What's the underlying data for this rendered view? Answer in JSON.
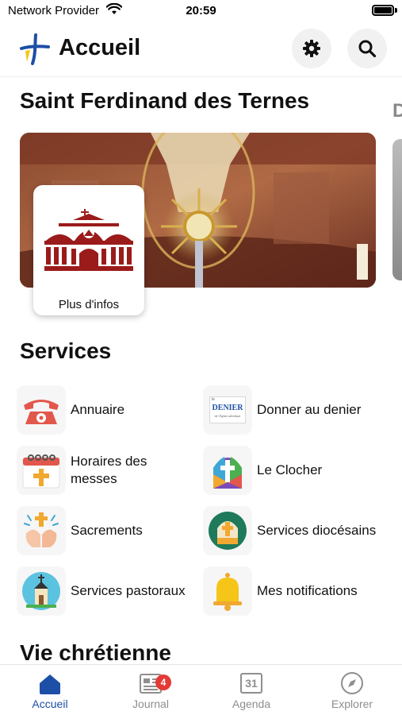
{
  "status": {
    "carrier": "Network Provider",
    "time": "20:59"
  },
  "header": {
    "title": "Accueil",
    "settings_icon": "gear-icon",
    "search_icon": "search-icon"
  },
  "parish": {
    "name": "Saint Ferdinand des Ternes",
    "next_name_partial": "D",
    "info_label": "Plus d'infos"
  },
  "services": {
    "title": "Services",
    "items": [
      {
        "label": "Annuaire",
        "icon": "telephone-icon"
      },
      {
        "label": "Donner au denier",
        "icon": "denier-icon",
        "icon_text": "DENIER",
        "icon_subtext": "de l'Église catholique",
        "icon_top": "le"
      },
      {
        "label": "Horaires des messes",
        "icon": "calendar-cross-icon"
      },
      {
        "label": "Le Clocher",
        "icon": "stained-glass-cross-icon"
      },
      {
        "label": "Sacrements",
        "icon": "praying-hands-icon"
      },
      {
        "label": "Services diocésains",
        "icon": "mitre-icon"
      },
      {
        "label": "Services pastoraux",
        "icon": "chapel-icon"
      },
      {
        "label": "Mes notifications",
        "icon": "bell-icon"
      }
    ]
  },
  "vie": {
    "title": "Vie chrétienne"
  },
  "tabs": [
    {
      "label": "Accueil",
      "icon": "home-icon",
      "active": true
    },
    {
      "label": "Journal",
      "icon": "newspaper-icon",
      "badge": "4"
    },
    {
      "label": "Agenda",
      "icon": "calendar-icon",
      "day": "31"
    },
    {
      "label": "Explorer",
      "icon": "compass-icon"
    }
  ],
  "colors": {
    "accent": "#1d4fa6",
    "badge": "#e53935",
    "logo_yellow": "#f5c518",
    "church_red": "#9b1b1b"
  }
}
